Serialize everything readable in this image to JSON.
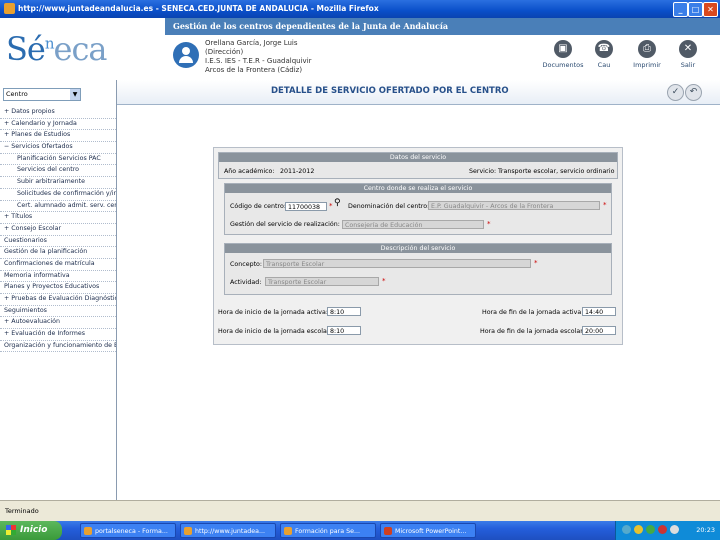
{
  "window": {
    "title": "http://www.juntadeandalucia.es - SENECA.CED.JUNTA DE ANDALUCIA - Mozilla Firefox",
    "min": "_",
    "max": "□",
    "close": "✕"
  },
  "header": {
    "band_title": "Gestión de los centros dependientes de la Junta de Andalucía",
    "logo_s": "Sé",
    "logo_n": "n",
    "logo_eca": "eca",
    "user_line1": "Orellana García, Jorge Luis",
    "user_line2": "(Dirección)",
    "user_line3": "I.E.S. IES - T.E.R - Guadalquivir",
    "user_line4": "Arcos de la Frontera (Cádiz)",
    "buttons": [
      {
        "label": "Documentos",
        "icon": "documents-icon",
        "glyph": "▣"
      },
      {
        "label": "Cau",
        "icon": "support-icon",
        "glyph": "☎"
      },
      {
        "label": "Imprimir",
        "icon": "print-icon",
        "glyph": "⎙"
      },
      {
        "label": "Salir",
        "icon": "exit-icon",
        "glyph": "✕"
      }
    ]
  },
  "sidebar": {
    "profile_select": "Centro",
    "items": [
      {
        "label": "+ Datos propios",
        "sub": false
      },
      {
        "label": "+ Calendario y Jornada",
        "sub": false
      },
      {
        "label": "+ Planes de Estudios",
        "sub": false
      },
      {
        "label": "− Servicios Ofertados",
        "sub": false
      },
      {
        "label": "Planificación Servicios PAC",
        "sub": true
      },
      {
        "label": "Servicios del centro",
        "sub": true
      },
      {
        "label": "Subir arbitrariamente",
        "sub": true
      },
      {
        "label": "Solicitudes de confirmación y/ine",
        "sub": true
      },
      {
        "label": "Cert. alumnado admit. serv. certi",
        "sub": true
      },
      {
        "label": "+ Títulos",
        "sub": false
      },
      {
        "label": "+ Consejo Escolar",
        "sub": false
      },
      {
        "label": "Cuestionarios",
        "sub": false
      },
      {
        "label": "Gestión de la planificación",
        "sub": false
      },
      {
        "label": "Confirmaciones de matrícula",
        "sub": false
      },
      {
        "label": "Memoria informativa",
        "sub": false
      },
      {
        "label": "Planes y Proyectos Educativos",
        "sub": false
      },
      {
        "label": "+ Pruebas de Evaluación Diagnóstica",
        "sub": false
      },
      {
        "label": "Seguimientos",
        "sub": false
      },
      {
        "label": "+ Autoevaluación",
        "sub": false
      },
      {
        "label": "+ Evaluación de Informes",
        "sub": false
      },
      {
        "label": "Organización y funcionamiento de ED",
        "sub": false
      }
    ]
  },
  "main": {
    "title": "DETALLE DE SERVICIO OFERTADO POR EL CENTRO",
    "accept_glyph": "✓",
    "back_glyph": "↶",
    "form": {
      "section1_title": "Datos del servicio",
      "anio_label": "Año académico:",
      "anio_value": "2011-2012",
      "servicio_label": "Servicio:",
      "servicio_value": "Transporte escolar, servicio ordinario",
      "section2_title": "Centro donde se realiza el servicio",
      "codigo_label": "Código de centro:",
      "codigo_value": "11700038",
      "denominacion_label": "Denominación del centro:",
      "denominacion_value": "E.P. Guadalquivir - Arcos de la Frontera",
      "gestion_label": "Gestión del servicio de realización:",
      "gestion_value": "Consejería de Educación",
      "section3_title": "Descripción del servicio",
      "concepto_label": "Concepto:",
      "concepto_value": "Transporte Escolar",
      "actividad_label": "Actividad:",
      "actividad_value": "Transporte Escolar",
      "inicio_activa_label": "Hora de inicio de la jornada activa:",
      "inicio_activa_value": "8:10",
      "fin_activa_label": "Hora de fin de la jornada activa:",
      "fin_activa_value": "14:40",
      "inicio_escolar_label": "Hora de inicio de la jornada escolar:",
      "inicio_escolar_value": "8:10",
      "fin_escolar_label": "Hora de fin de la jornada escolar:",
      "fin_escolar_value": "20:00"
    }
  },
  "statusbar": {
    "text": "Terminado"
  },
  "taskbar": {
    "start": "Inicio",
    "tasks": [
      "portalseneca - Forma...",
      "http://www.juntadea...",
      "Formación para Se...",
      "Microsoft PowerPoint..."
    ],
    "clock": "20:23"
  }
}
